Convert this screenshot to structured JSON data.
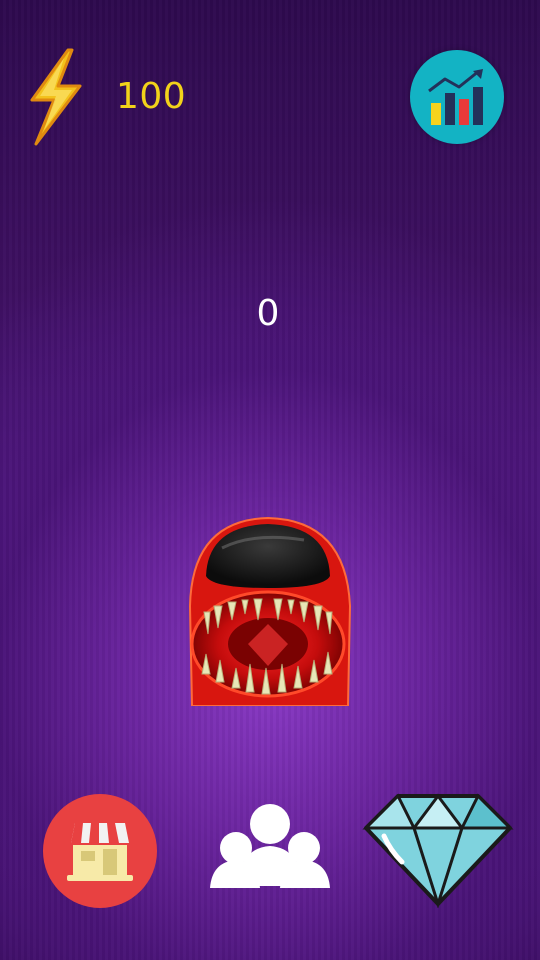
{
  "hud": {
    "energy_icon": "lightning-bolt-icon",
    "energy_value": "100",
    "stats_icon": "stats-chart-icon"
  },
  "game": {
    "score": "0",
    "character": "red-impostor-monster"
  },
  "bottom_bar": {
    "shop_icon": "shop-store-icon",
    "friends_icon": "friends-group-icon",
    "gems_icon": "diamond-icon"
  },
  "colors": {
    "background": "#4a1478",
    "energy_text": "#f2d21a",
    "stats_button": "#13b3c4",
    "shop_button": "#e84141",
    "diamond": "#7fd3de"
  }
}
